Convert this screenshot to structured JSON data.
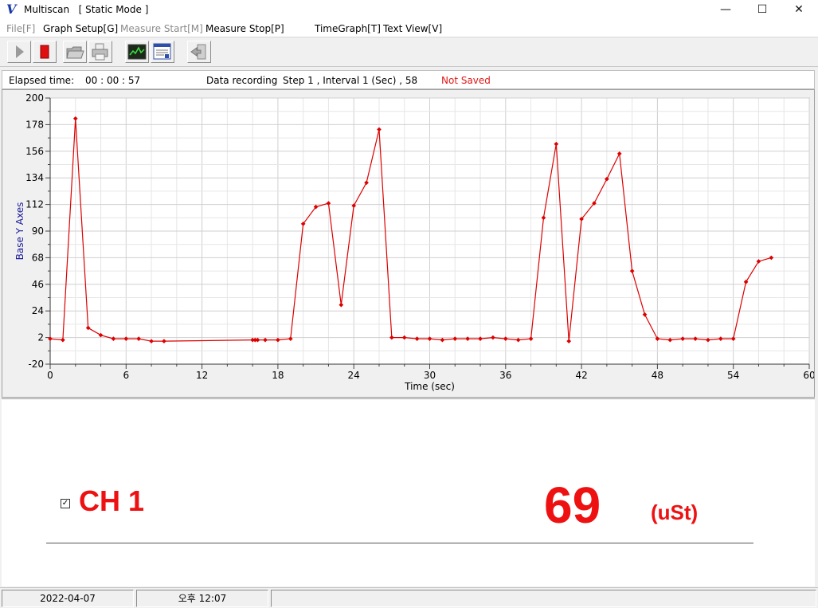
{
  "window": {
    "logo": "V",
    "title": "Multiscan   [ Static Mode ]",
    "minimize": "—",
    "maximize": "☐",
    "close": "✕"
  },
  "menu": [
    {
      "label": "File[F]",
      "enabled": false
    },
    {
      "label": "Graph Setup[G]",
      "enabled": true
    },
    {
      "label": "Measure Start[M]",
      "enabled": false
    },
    {
      "label": "Measure Stop[P]",
      "enabled": true
    },
    {
      "label": "TimeGraph[T]",
      "enabled": true
    },
    {
      "label": "Text View[V]",
      "enabled": true
    }
  ],
  "toolbar": {
    "icons": [
      "play-icon",
      "stop-icon",
      "open-folder-icon",
      "print-icon",
      "time-graph-icon",
      "text-view-icon",
      "exit-icon"
    ]
  },
  "status": {
    "elapsed_label": "Elapsed time:",
    "elapsed_value": "00 : 00 : 57",
    "recording_label": "Data recording",
    "step_info": "Step  1 , Interval  1 (Sec) , 58",
    "save_state": "Not Saved"
  },
  "colors": {
    "series": "#dd0000",
    "accent_red": "#ee1111",
    "axis_title": "#1a1a99"
  },
  "chart_data": {
    "type": "line",
    "xlabel": "Time (sec)",
    "ylabel": "Base Y Axes",
    "xlim": [
      0,
      60
    ],
    "ylim": [
      -20,
      200
    ],
    "x_ticks": [
      0,
      6,
      12,
      18,
      24,
      30,
      36,
      42,
      48,
      54,
      60
    ],
    "y_ticks": [
      -20,
      2,
      24,
      46,
      68,
      90,
      112,
      134,
      156,
      178,
      200
    ],
    "grid": true,
    "series": [
      {
        "x": [
          0,
          1,
          2,
          3,
          4,
          5,
          6,
          7,
          8,
          9,
          16,
          16.2,
          16.4,
          17,
          18,
          19,
          20,
          21,
          22,
          23,
          24,
          25,
          26,
          27,
          28,
          29,
          30,
          31,
          32,
          33,
          34,
          35,
          36,
          37,
          38,
          39,
          40,
          41,
          42,
          43,
          44,
          45,
          46,
          47,
          48,
          49,
          50,
          51,
          52,
          53,
          54,
          55,
          56,
          57
        ],
        "values": [
          1,
          0,
          183,
          10,
          4,
          1,
          1,
          1,
          -1,
          -1,
          0,
          0,
          0,
          0,
          0,
          1,
          96,
          110,
          113,
          29,
          111,
          130,
          174,
          2,
          2,
          1,
          1,
          0,
          1,
          1,
          1,
          2,
          1,
          0,
          1,
          101,
          162,
          -1,
          100,
          113,
          133,
          154,
          57,
          21,
          1,
          0,
          1,
          1,
          0,
          1,
          1,
          48,
          65,
          68
        ]
      }
    ]
  },
  "channel": {
    "checked": "✓",
    "label": "CH 1",
    "value": "69",
    "unit": "(uSt)"
  },
  "statusbar": {
    "date": "2022-04-07",
    "time": "오후 12:07"
  }
}
